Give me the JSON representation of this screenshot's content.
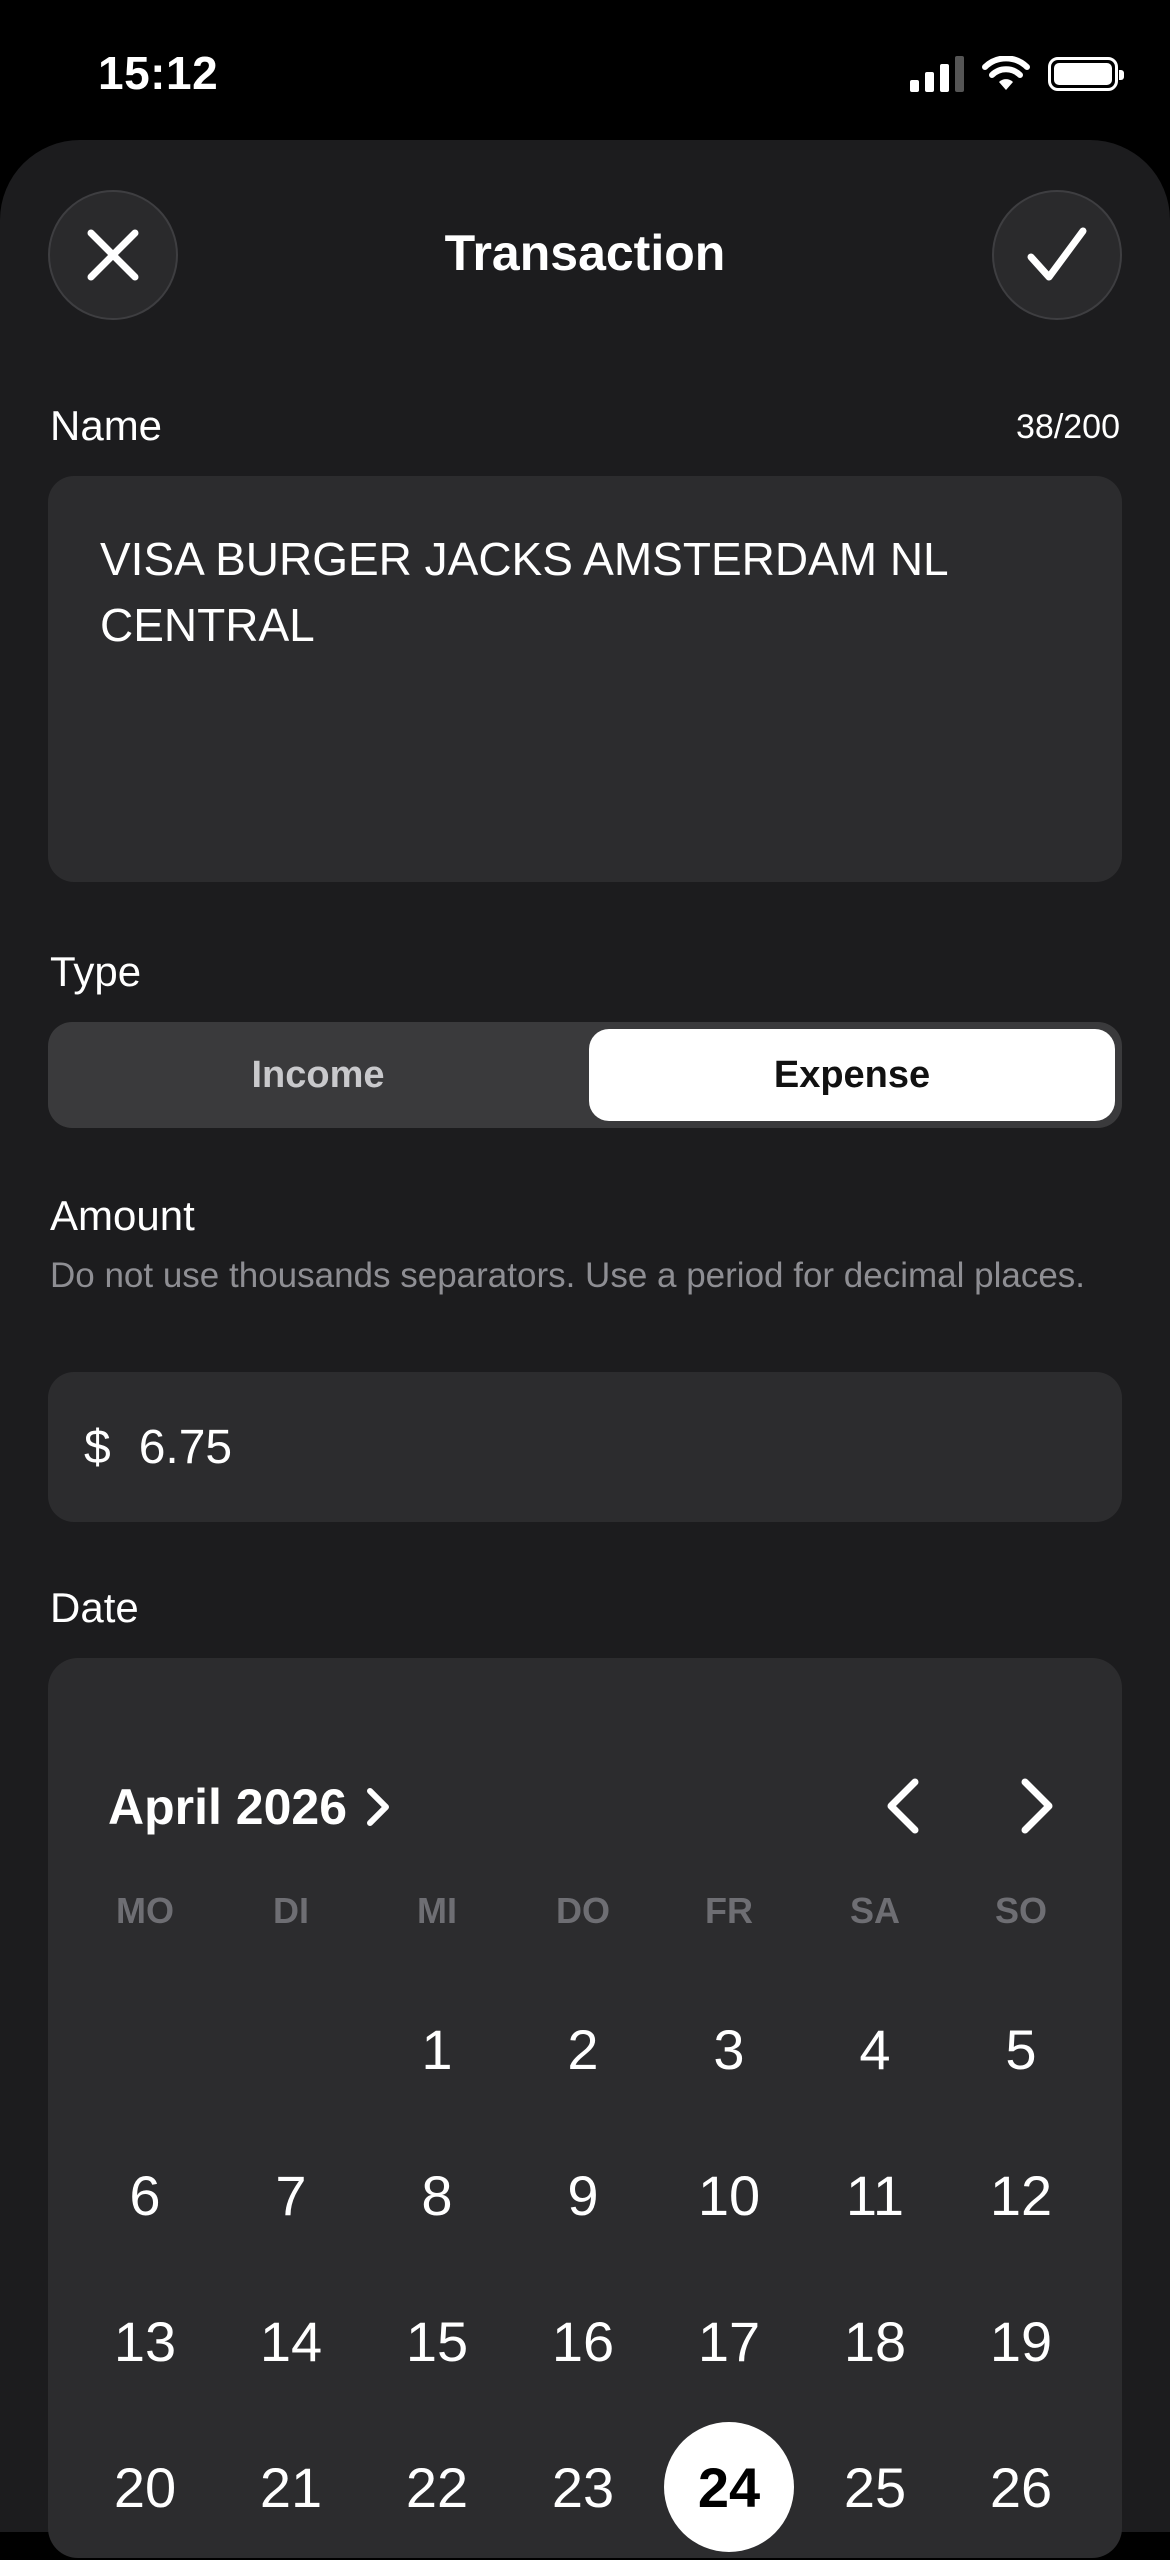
{
  "status": {
    "time": "15:12"
  },
  "sheet": {
    "title": "Transaction"
  },
  "name": {
    "label": "Name",
    "counter": "38/200",
    "value": "VISA BURGER JACKS AMSTERDAM NL CENTRAL"
  },
  "type": {
    "label": "Type",
    "options": [
      "Income",
      "Expense"
    ],
    "selected": "Expense"
  },
  "amount": {
    "label": "Amount",
    "hint": "Do not use thousands separators. Use a period for decimal places.",
    "currency": "$",
    "value": "6.75"
  },
  "date": {
    "label": "Date",
    "month_label": "April 2026",
    "weekdays": [
      "MO",
      "DI",
      "MI",
      "DO",
      "FR",
      "SA",
      "SO"
    ],
    "days": [
      "",
      "",
      "1",
      "2",
      "3",
      "4",
      "5",
      "6",
      "7",
      "8",
      "9",
      "10",
      "11",
      "12",
      "13",
      "14",
      "15",
      "16",
      "17",
      "18",
      "19",
      "20",
      "21",
      "22",
      "23",
      "24",
      "25",
      "26"
    ],
    "selected_day": "24"
  },
  "icons": {
    "close": "close-icon",
    "confirm": "checkmark-icon",
    "month_expand": "chevron-right-icon",
    "prev": "chevron-left-icon",
    "next": "chevron-right-icon"
  }
}
